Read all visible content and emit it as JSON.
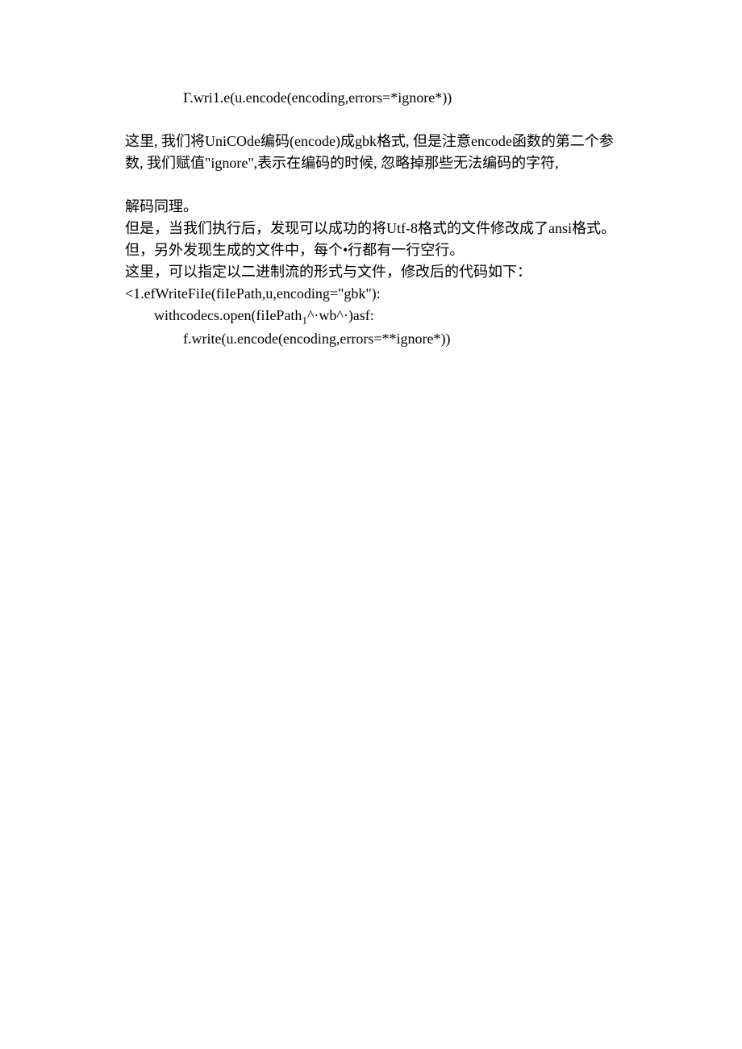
{
  "lines": {
    "l1": "Γ.wri1.e(u.encode(encoding,errors=*ignore*))",
    "l2": "这里, 我们将UniCOde编码(encode)成gbk格式, 但是注意encode函数的第二个参数, 我们赋值\"ignore\",表示在编码的时候, 忽略掉那些无法编码的字符,",
    "l3": "解码同理。",
    "l4": "但是，当我们执行后，发现可以成功的将Utf-8格式的文件修改成了ansi格式。",
    "l5": "但，另外发现生成的文件中，每个•行都有一行空行。",
    "l6": "这里，可以指定以二进制流的形式与文件，修改后的代码如下：",
    "l7": "<1.efWriteFiIe(fiIePath,u,encoding=\"gbk\"):",
    "l8a": "withcodecs.open(fiIePath",
    "l8sub": "1",
    "l8b": "^·wb^·)asf:",
    "l9": "f.write(u.encode(encoding,errors=**ignore*))"
  }
}
